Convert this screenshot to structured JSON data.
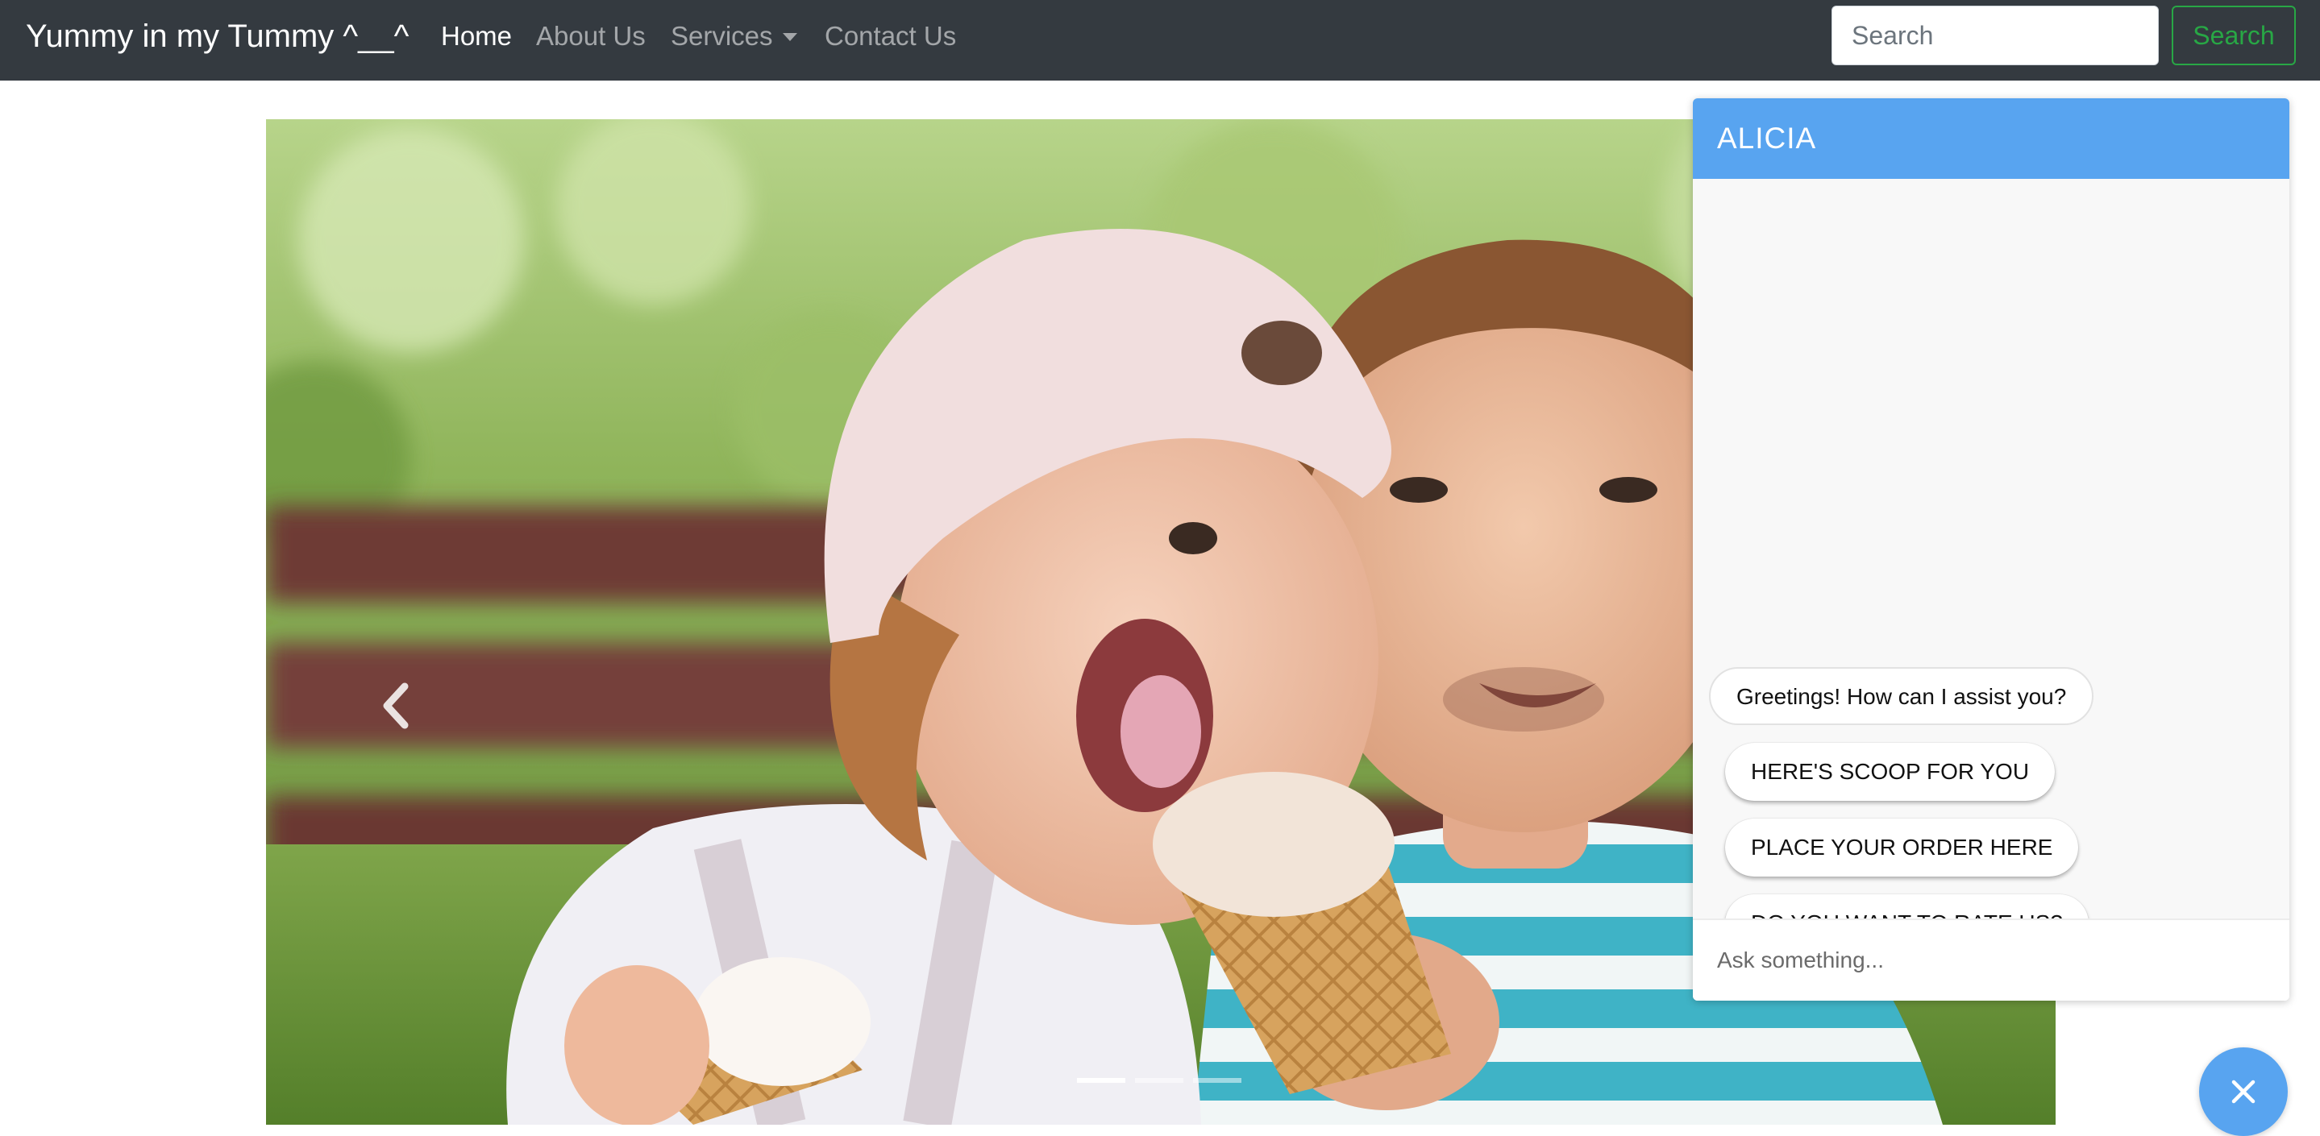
{
  "navbar": {
    "brand": "Yummy in my Tummy ^__^",
    "links": [
      {
        "label": "Home",
        "active": true
      },
      {
        "label": "About Us"
      },
      {
        "label": "Services",
        "dropdown": true
      },
      {
        "label": "Contact Us"
      }
    ],
    "search": {
      "placeholder": "Search",
      "button_label": "Search"
    }
  },
  "carousel": {
    "image_icon": "kids-eating-ice-cream-photo",
    "prev_icon": "chevron-left-icon",
    "slide_count": 3,
    "active_slide": 1
  },
  "chat": {
    "title": "ALICIA",
    "greeting": "Greetings! How can I assist you?",
    "quick_replies": [
      "HERE'S SCOOP FOR YOU",
      "PLACE YOUR ORDER HERE",
      "DO YOU WANT TO RATE US?"
    ],
    "input_placeholder": "Ask something..."
  },
  "fab": {
    "icon": "close-icon"
  },
  "colors": {
    "navbar_bg": "#343a40",
    "accent_blue": "#58a4f0",
    "search_green": "#28a745"
  }
}
